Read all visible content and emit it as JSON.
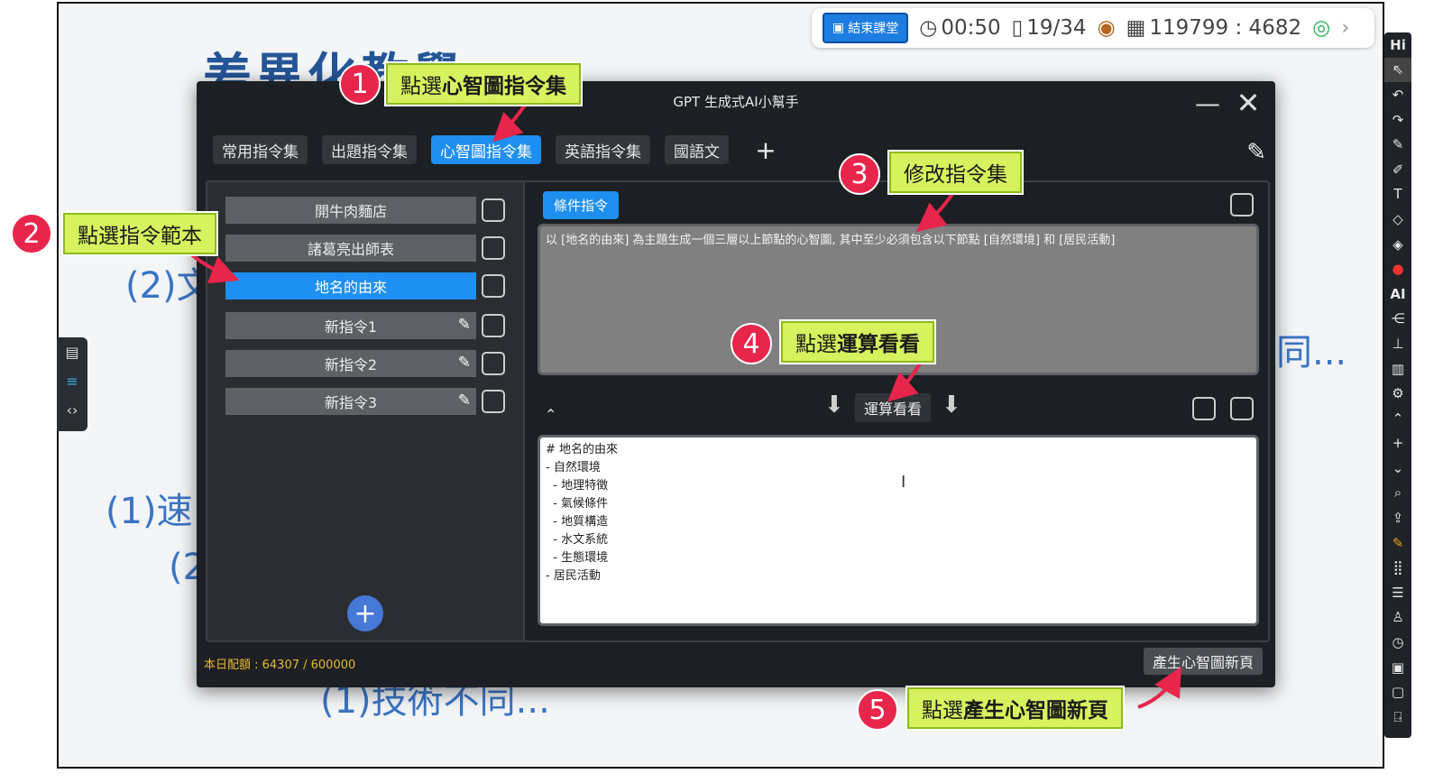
{
  "slide": {
    "title": "差異化教學",
    "line_2_text": "(2)文",
    "line_3_text": "(1)速",
    "line_4_text": "(2",
    "line_right_text": "同...",
    "line_bottom_text": "(1)技術不同..."
  },
  "status_bar": {
    "end_class_label": "結束課堂",
    "timer": "00:50",
    "pages": "19/34",
    "room_code": "119799 : 4682"
  },
  "dialog": {
    "title": "GPT 生成式AI小幫手",
    "tabs": [
      "常用指令集",
      "出題指令集",
      "心智圖指令集",
      "英語指令集",
      "國語文"
    ],
    "commands": [
      "開牛肉麵店",
      "諸葛亮出師表",
      "地名的由來",
      "新指令1",
      "新指令2",
      "新指令3"
    ],
    "condition_tag": "條件指令",
    "prompt_text": "以 [地名的由來] 為主題生成一個三層以上節點的心智圖, 其中至少必須包含以下節點 [自然環境] 和 [居民活動]",
    "run_label": "運算看看",
    "result_lines": [
      "# 地名的由來",
      "",
      "- 自然環境",
      "  - 地理特徵",
      "  - 氣候條件",
      "  - 地質構造",
      "  - 水文系統",
      "  - 生態環境",
      "",
      "- 居民活動"
    ],
    "quota": "本日配額 : 64307 / 600000",
    "generate_label": "產生心智圖新頁"
  },
  "annotations": {
    "step1": {
      "num": "1",
      "prefix": "點選",
      "bold": "心智圖指令集"
    },
    "step2": {
      "num": "2",
      "prefix": "點選指令範本",
      "bold": ""
    },
    "step3": {
      "num": "3",
      "prefix": "修改指令集",
      "bold": ""
    },
    "step4": {
      "num": "4",
      "prefix": "點選",
      "bold": "運算看看"
    },
    "step5": {
      "num": "5",
      "prefix": "點選",
      "bold": "產生心智圖新頁"
    }
  },
  "colors": {
    "accent": "#1e8ff0",
    "callout": "#d7f25e",
    "badge": "#e8254b"
  }
}
